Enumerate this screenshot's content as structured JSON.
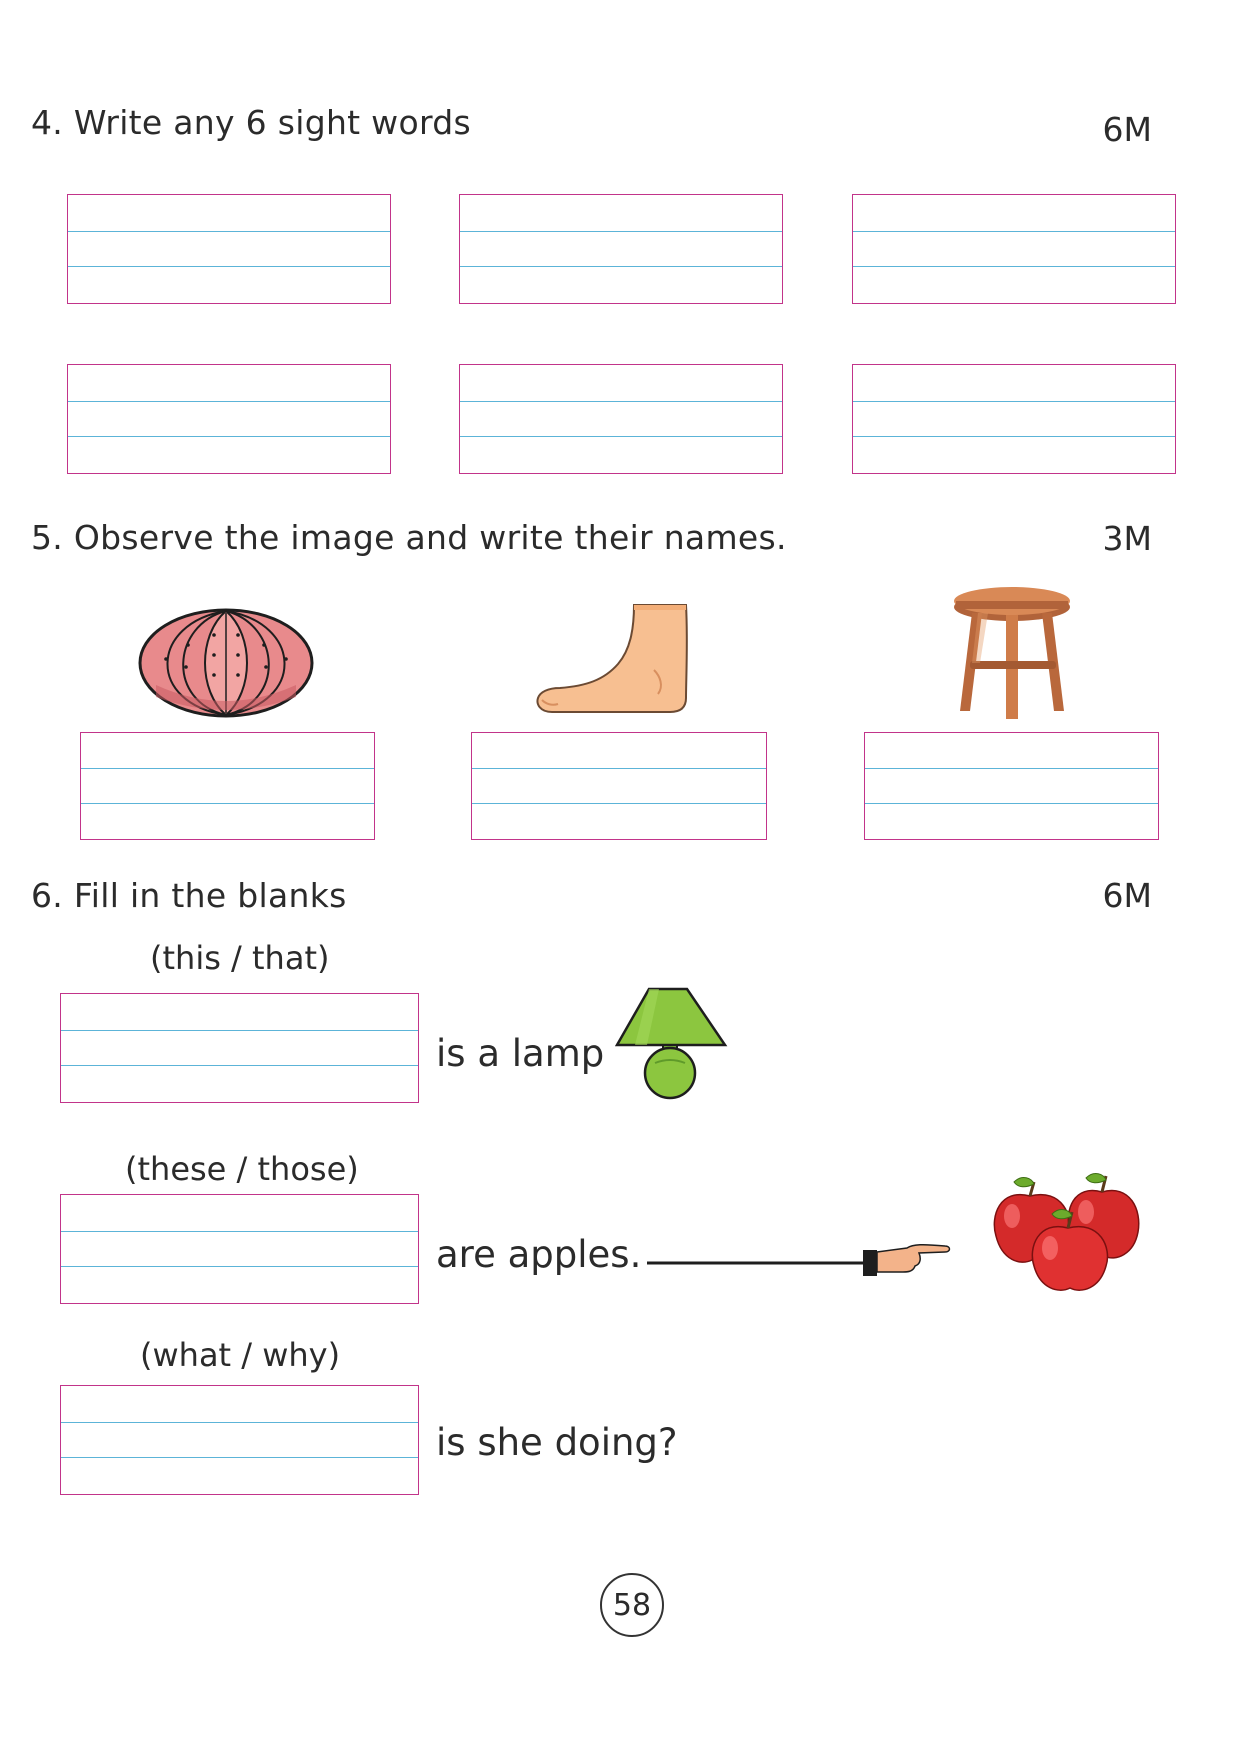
{
  "questions": {
    "q4": {
      "title": "4. Write any 6 sight words",
      "marks": "6M"
    },
    "q5": {
      "title": "5. Observe the image and write their names.",
      "marks": "3M",
      "images": [
        "sea-urchin-shell-icon",
        "foot-icon",
        "stool-icon"
      ]
    },
    "q6": {
      "title": "6. Fill in the blanks",
      "marks": "6M",
      "items": [
        {
          "hint": "(this / that)",
          "sentence": "is a lamp",
          "image": "lamp-icon"
        },
        {
          "hint": "(these / those)",
          "sentence": "are apples.",
          "image": "apples-icon"
        },
        {
          "hint": "(what / why)",
          "sentence": "is she doing?"
        }
      ]
    }
  },
  "colors": {
    "box_border": "#c2348a",
    "box_lines": "#5cb4d8"
  },
  "page_number": "58"
}
